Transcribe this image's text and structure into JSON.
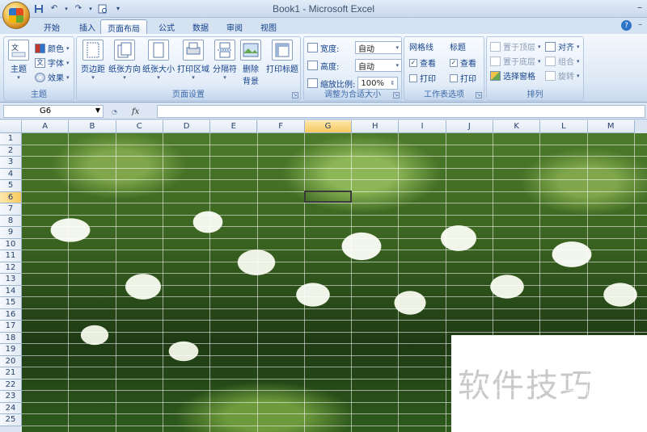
{
  "window": {
    "title": "Book1 - Microsoft Excel"
  },
  "qat": {
    "save_icon": "save-icon",
    "undo_icon": "undo-icon",
    "redo_icon": "redo-icon",
    "print_preview_icon": "print-preview-icon"
  },
  "tabs": [
    {
      "label": "开始"
    },
    {
      "label": "插入"
    },
    {
      "label": "页面布局"
    },
    {
      "label": "公式"
    },
    {
      "label": "数据"
    },
    {
      "label": "审阅"
    },
    {
      "label": "视图"
    }
  ],
  "ribbon": {
    "theme_group": {
      "label": "主题",
      "theme_button": "主题",
      "colors": "颜色",
      "fonts": "字体",
      "effects": "效果"
    },
    "page_setup_group": {
      "label": "页面设置",
      "margins": "页边距",
      "orientation": "纸张方向",
      "size": "纸张大小",
      "print_area": "打印区域",
      "breaks": "分隔符",
      "background_line1": "删除",
      "background_line2": "背景",
      "print_titles": "打印标题"
    },
    "scale_group": {
      "label": "调整为合适大小",
      "width_label": "宽度:",
      "width_value": "自动",
      "height_label": "高度:",
      "height_value": "自动",
      "scale_label": "缩放比例:",
      "scale_value": "100%"
    },
    "sheet_options_group": {
      "label": "工作表选项",
      "gridlines": "网格线",
      "headings": "标题",
      "view": "查看",
      "print": "打印"
    },
    "arrange_group": {
      "label": "排列",
      "bring_front": "置于顶层",
      "send_back": "置于底层",
      "selection_pane": "选择窗格",
      "align": "对齐",
      "group": "组合",
      "rotate": "旋转"
    }
  },
  "formula_bar": {
    "name_box": "G6",
    "fx": "fx",
    "formula": ""
  },
  "columns": [
    "A",
    "B",
    "C",
    "D",
    "E",
    "F",
    "G",
    "H",
    "I",
    "J",
    "K",
    "L",
    "M"
  ],
  "selected_column": "G",
  "rows": [
    "1",
    "2",
    "3",
    "4",
    "5",
    "6",
    "7",
    "8",
    "9",
    "10",
    "11",
    "12",
    "13",
    "14",
    "15",
    "16",
    "17",
    "18",
    "19",
    "20",
    "21",
    "22",
    "23",
    "24",
    "25"
  ],
  "selected_row": "6",
  "watermark": "软件技巧",
  "colors": {
    "accent": "#f8c85c",
    "ribbon_text": "#15428b"
  }
}
